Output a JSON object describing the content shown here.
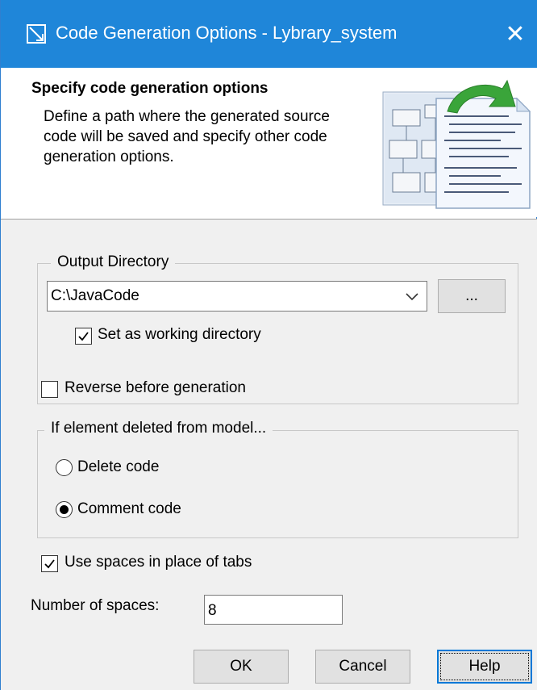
{
  "window": {
    "title": "Code Generation Options - Lybrary_system",
    "close_glyph": "✕",
    "title_bar_color": "#1f86d9"
  },
  "header": {
    "title": "Specify code generation options",
    "description": "Define a path where the generated source code will be saved and specify other code generation options.",
    "illustration_icon": "diagram-to-code-icon"
  },
  "output_directory": {
    "legend": "Output Directory",
    "path_value": "C:\\JavaCode",
    "browse_label": "...",
    "working_dir_checkbox": {
      "label": "Set as working directory",
      "checked": true
    }
  },
  "reverse_checkbox": {
    "label": "Reverse before generation",
    "checked": false
  },
  "deleted_element_group": {
    "legend": "If element deleted from model...",
    "options": [
      {
        "label": "Delete code",
        "selected": false
      },
      {
        "label": "Comment code",
        "selected": true
      }
    ]
  },
  "spaces_checkbox": {
    "label": "Use spaces in place of tabs",
    "checked": true
  },
  "number_of_spaces": {
    "label": "Number of spaces:",
    "value": "8"
  },
  "buttons": {
    "ok": "OK",
    "cancel": "Cancel",
    "help": "Help"
  }
}
